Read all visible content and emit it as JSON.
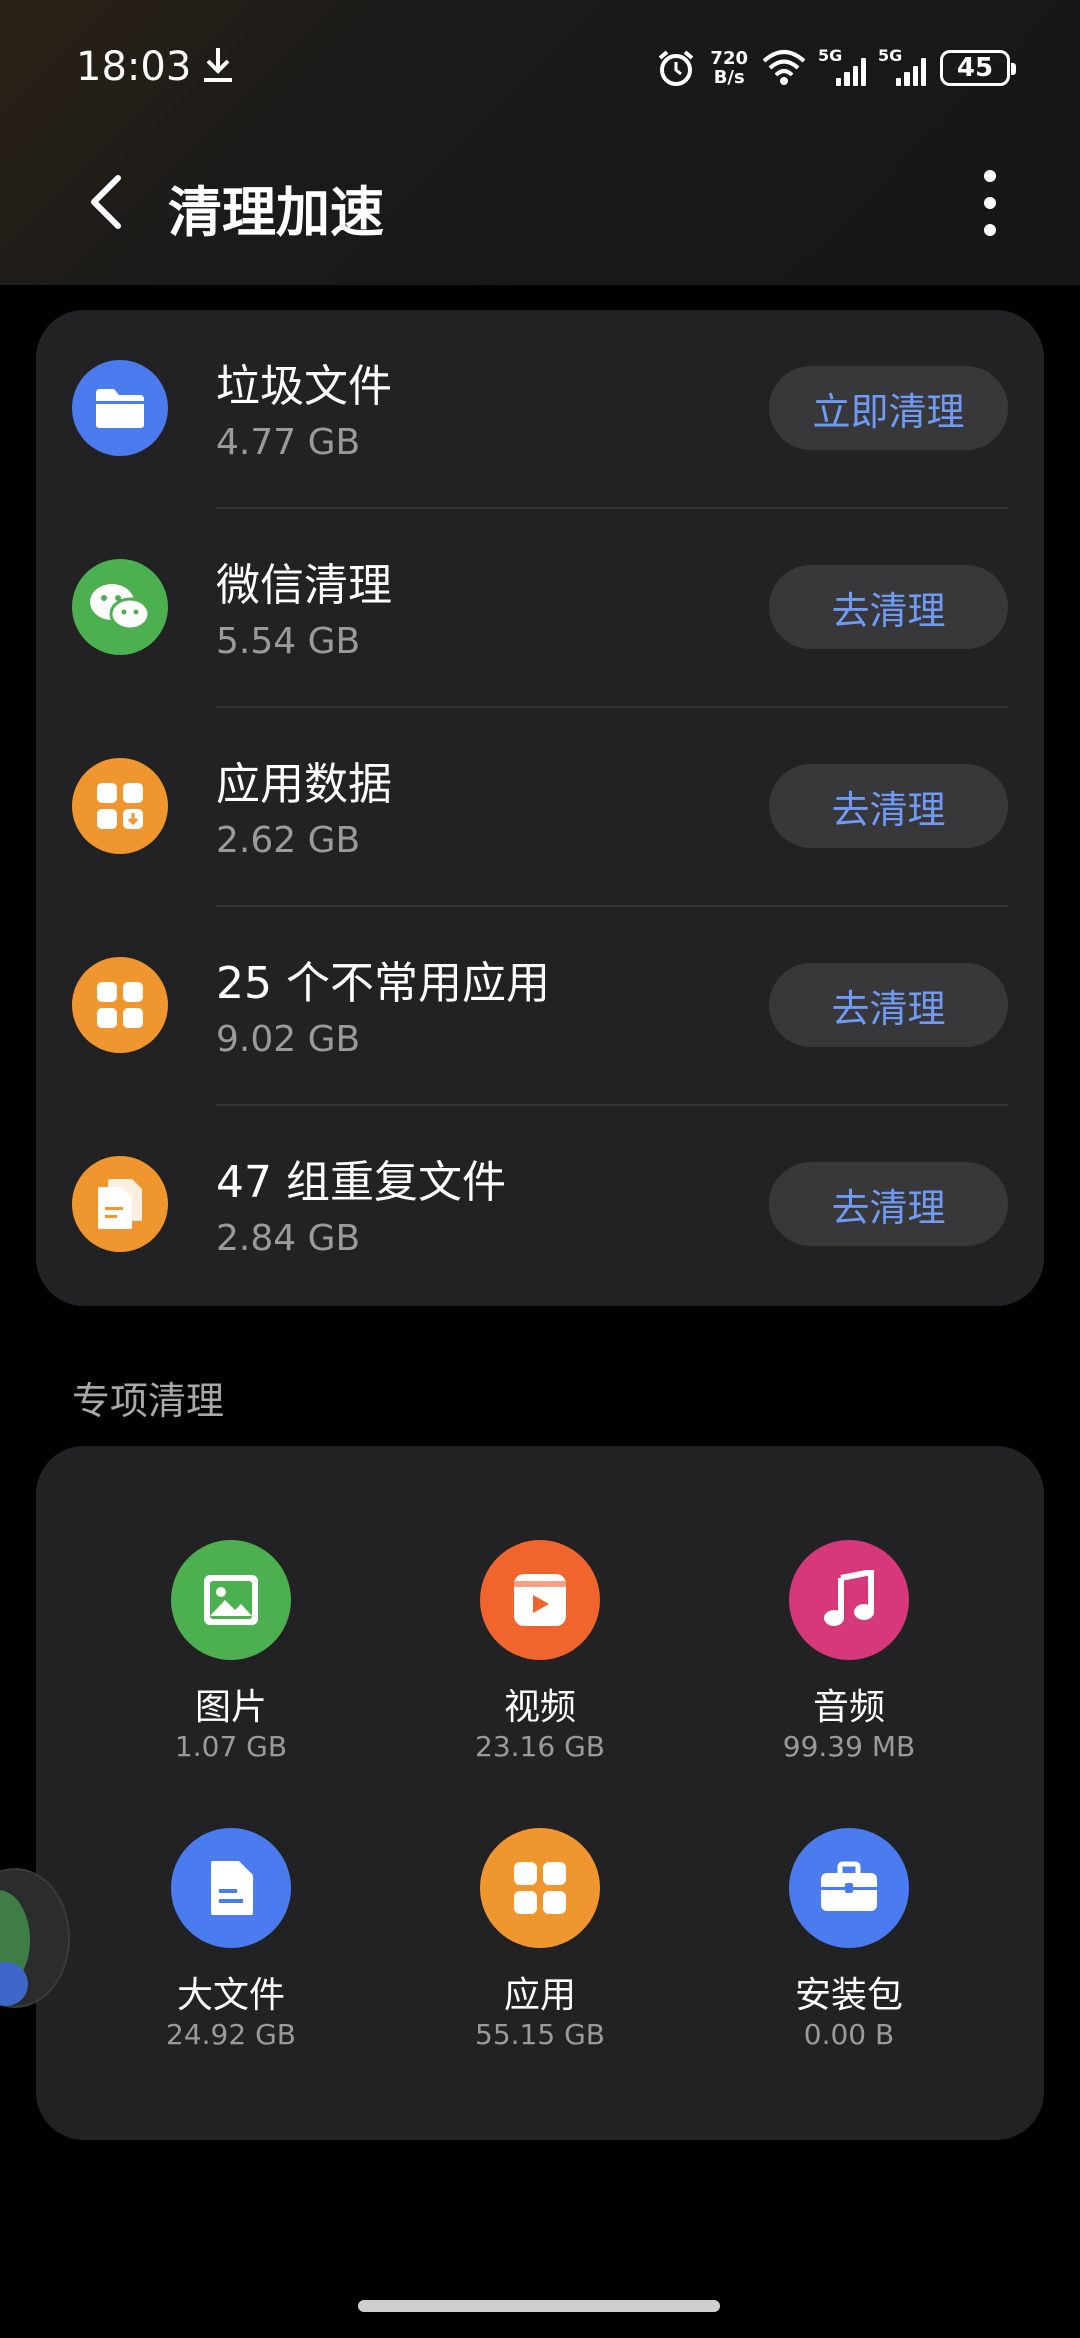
{
  "status_bar": {
    "time": "18:03",
    "speed_top": "720",
    "speed_bottom": "B/s",
    "sim1": "5G",
    "sim2": "5G",
    "battery": "45"
  },
  "header": {
    "title": "清理加速"
  },
  "cleanup_items": [
    {
      "title": "垃圾文件",
      "size": "4.77 GB",
      "button": "立即清理",
      "icon": "folder-icon",
      "color": "#4a7cf0"
    },
    {
      "title": "微信清理",
      "size": "5.54 GB",
      "button": "去清理",
      "icon": "wechat-icon",
      "color": "#4caf50"
    },
    {
      "title": "应用数据",
      "size": "2.62 GB",
      "button": "去清理",
      "icon": "app-data-icon",
      "color": "#f0962e"
    },
    {
      "title": "25 个不常用应用",
      "size": "9.02 GB",
      "button": "去清理",
      "icon": "apps-grid-icon",
      "color": "#f0962e"
    },
    {
      "title": "47 组重复文件",
      "size": "2.84 GB",
      "button": "去清理",
      "icon": "duplicate-files-icon",
      "color": "#f0962e"
    }
  ],
  "special_section": {
    "label": "专项清理",
    "items": [
      {
        "label": "图片",
        "size": "1.07 GB",
        "icon": "image-icon",
        "color": "#4caf50"
      },
      {
        "label": "视频",
        "size": "23.16 GB",
        "icon": "video-icon",
        "color": "#f0642e"
      },
      {
        "label": "音频",
        "size": "99.39 MB",
        "icon": "music-icon",
        "color": "#d6387a"
      },
      {
        "label": "大文件",
        "size": "24.92 GB",
        "icon": "document-icon",
        "color": "#4a7cf0"
      },
      {
        "label": "应用",
        "size": "55.15 GB",
        "icon": "apps-grid-icon",
        "color": "#f0962e"
      },
      {
        "label": "安装包",
        "size": "0.00 B",
        "icon": "briefcase-icon",
        "color": "#4a7cf0"
      }
    ]
  }
}
